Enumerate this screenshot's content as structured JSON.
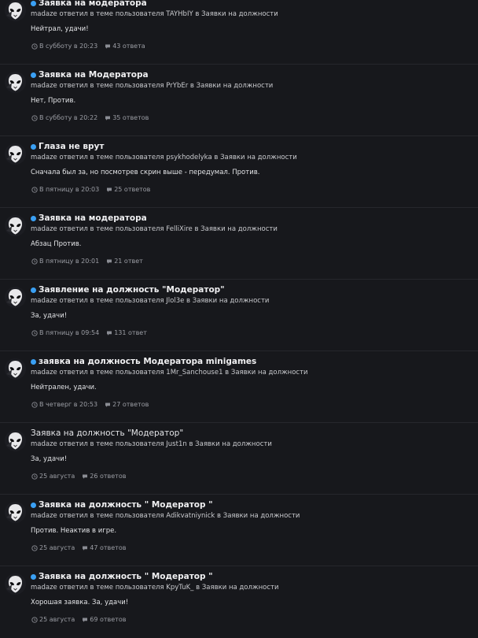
{
  "activity": {
    "items": [
      {
        "title": "Заявка на модератора",
        "unread": true,
        "meta": "madaze ответил в теме пользователя TAYHbIY в Заявки на должности",
        "text": "Нейтрал, удачи!",
        "time": "В субботу в 20:23",
        "replies": "43 ответа"
      },
      {
        "title": "Заявка на Модератора",
        "unread": true,
        "meta": "madaze ответил в теме пользователя PrYbEr в Заявки на должности",
        "text": "Нет, Против.",
        "time": "В субботу в 20:22",
        "replies": "35 ответов"
      },
      {
        "title": "Глаза не врут",
        "unread": true,
        "meta": "madaze ответил в теме пользователя psykhodelyka в Заявки на должности",
        "text": "Сначала был за, но посмотрев скрин выше - передумал. Против.",
        "time": "В пятницу в 20:03",
        "replies": "25 ответов"
      },
      {
        "title": "Заявка на модератора",
        "unread": true,
        "meta": "madaze ответил в теме пользователя FelliXire в Заявки на должности",
        "text": "Абзац Против.",
        "time": "В пятницу в 20:01",
        "replies": "21 ответ"
      },
      {
        "title": "Заявление на должность \"Модератор\"",
        "unread": true,
        "meta": "madaze ответил в теме пользователя Jlol3e в Заявки на должности",
        "text": "За, удачи!",
        "time": "В пятницу в 09:54",
        "replies": "131 ответ"
      },
      {
        "title": "заявка на должность Модератора minigames",
        "unread": true,
        "meta": "madaze ответил в теме пользователя 1Mr_Sanchouse1 в Заявки на должности",
        "text": "Нейтрален, удачи.",
        "time": "В четверг в 20:53",
        "replies": "27 ответов"
      },
      {
        "title": "Заявка на должность \"Модератор\"",
        "unread": false,
        "meta": "madaze ответил в теме пользователя Just1n в Заявки на должности",
        "text": "За, удачи!",
        "time": "25 августа",
        "replies": "26 ответов"
      },
      {
        "title": "Заявка на должность \" Модератор \"",
        "unread": true,
        "meta": "madaze ответил в теме пользователя Adikvatniynick в Заявки на должности",
        "text": "Против. Неактив в игре.",
        "time": "25 августа",
        "replies": "47 ответов"
      },
      {
        "title": "Заявка на должность \" Модератор \"",
        "unread": true,
        "meta": "madaze ответил в теме пользователя KpyTuK_ в Заявки на должности",
        "text": "Хорошая заявка. За, удачи!",
        "time": "25 августа",
        "replies": "69 ответов"
      }
    ]
  },
  "colors": {
    "background": "#17181c",
    "unread_dot": "#3aa0f4",
    "divider": "#26272c"
  },
  "icons": {
    "unread": "unread-dot-icon",
    "time": "clock-icon",
    "replies": "comment-icon",
    "avatar": "alien-mask-avatar"
  }
}
